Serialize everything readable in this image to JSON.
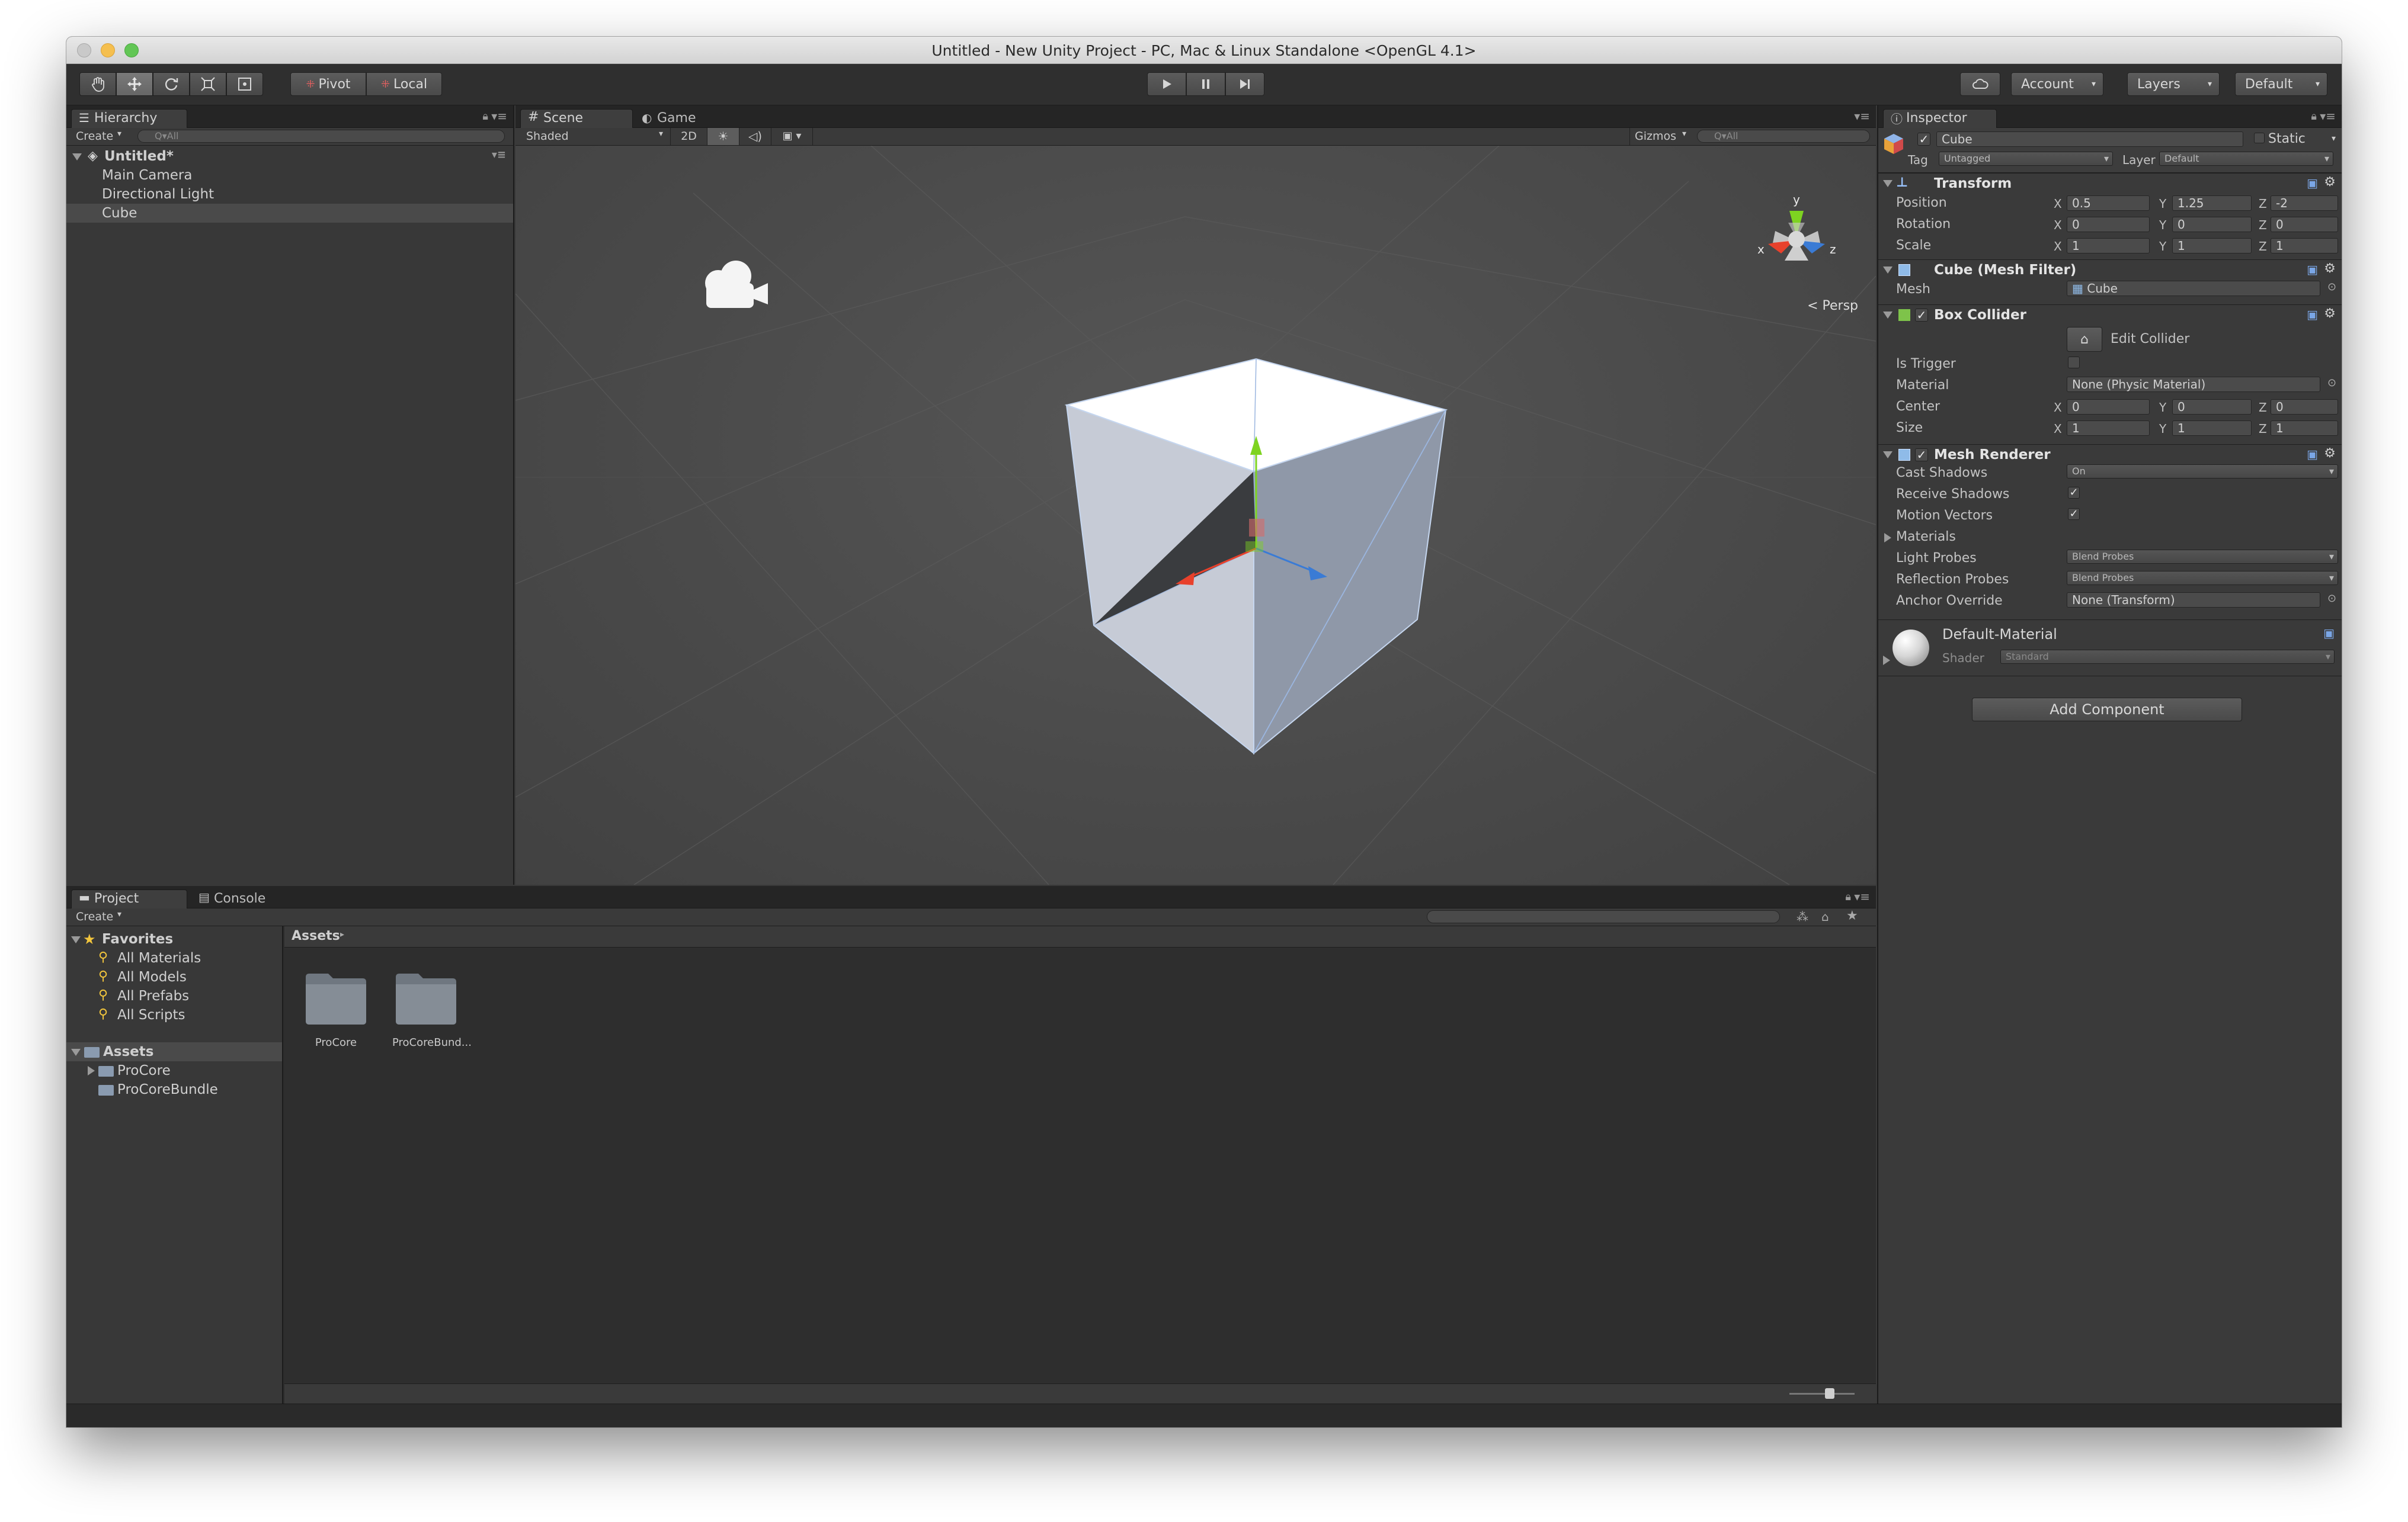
{
  "window": {
    "title": "Untitled - New Unity Project - PC, Mac & Linux Standalone <OpenGL 4.1>"
  },
  "toolbar": {
    "tools": [
      "hand-tool",
      "move-tool",
      "rotate-tool",
      "scale-tool",
      "rect-tool"
    ],
    "active_tool": "move-tool",
    "pivot_label": "Pivot",
    "local_label": "Local",
    "account_label": "Account",
    "layers_label": "Layers",
    "layout_label": "Default"
  },
  "hierarchy": {
    "tab_label": "Hierarchy",
    "create_label": "Create",
    "search_placeholder": "Q▾All",
    "scene_name": "Untitled*",
    "items": [
      "Main Camera",
      "Directional Light",
      "Cube"
    ],
    "selected": "Cube"
  },
  "scene_view": {
    "tabs": [
      "Scene",
      "Game"
    ],
    "shading_mode": "Shaded",
    "mode_2d_label": "2D",
    "gizmos_label": "Gizmos",
    "search_placeholder": "Q▾All",
    "projection_label": "Persp",
    "gizmo_axes": {
      "x": "x",
      "y": "y",
      "z": "z"
    }
  },
  "inspector": {
    "tab_label": "Inspector",
    "object_name": "Cube",
    "static_label": "Static",
    "tag_label": "Tag",
    "tag_value": "Untagged",
    "layer_label": "Layer",
    "layer_value": "Default",
    "transform": {
      "title": "Transform",
      "position_label": "Position",
      "rotation_label": "Rotation",
      "scale_label": "Scale",
      "position": {
        "x": "0.5",
        "y": "1.25",
        "z": "-2"
      },
      "rotation": {
        "x": "0",
        "y": "0",
        "z": "0"
      },
      "scale": {
        "x": "1",
        "y": "1",
        "z": "1"
      }
    },
    "mesh_filter": {
      "title": "Cube (Mesh Filter)",
      "mesh_label": "Mesh",
      "mesh_value": "Cube"
    },
    "box_collider": {
      "title": "Box Collider",
      "edit_label": "Edit Collider",
      "is_trigger_label": "Is Trigger",
      "material_label": "Material",
      "material_value": "None (Physic Material)",
      "center_label": "Center",
      "size_label": "Size",
      "center": {
        "x": "0",
        "y": "0",
        "z": "0"
      },
      "size": {
        "x": "1",
        "y": "1",
        "z": "1"
      }
    },
    "mesh_renderer": {
      "title": "Mesh Renderer",
      "cast_shadows_label": "Cast Shadows",
      "cast_shadows_value": "On",
      "receive_shadows_label": "Receive Shadows",
      "motion_vectors_label": "Motion Vectors",
      "materials_label": "Materials",
      "light_probes_label": "Light Probes",
      "light_probes_value": "Blend Probes",
      "reflection_probes_label": "Reflection Probes",
      "reflection_probes_value": "Blend Probes",
      "anchor_override_label": "Anchor Override",
      "anchor_override_value": "None (Transform)"
    },
    "material": {
      "name": "Default-Material",
      "shader_label": "Shader",
      "shader_value": "Standard"
    },
    "add_component_label": "Add Component"
  },
  "project": {
    "tabs": [
      "Project",
      "Console"
    ],
    "create_label": "Create",
    "favorites_label": "Favorites",
    "favorites": [
      "All Materials",
      "All Models",
      "All Prefabs",
      "All Scripts"
    ],
    "assets_label": "Assets",
    "asset_tree": [
      "ProCore",
      "ProCoreBundle"
    ],
    "breadcrumb": "Assets",
    "folders": [
      "ProCore",
      "ProCoreBund..."
    ]
  },
  "colors": {
    "selection": "#4a4a4a",
    "gizmo_x": "#e8412c",
    "gizmo_y": "#7ed321",
    "gizmo_z": "#3a7bd5"
  }
}
